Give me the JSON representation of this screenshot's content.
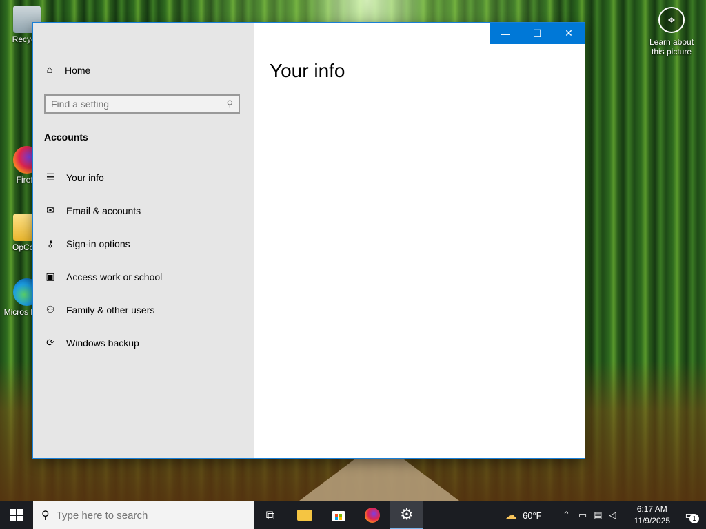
{
  "desktop": {
    "icons": [
      {
        "label": "Recycle",
        "icon": "recycle-bin-icon"
      },
      {
        "label": "Firefo",
        "icon": "firefox-icon"
      },
      {
        "label": "OpCore",
        "icon": "folder-icon"
      },
      {
        "label": "Micros Edge",
        "icon": "edge-icon"
      }
    ],
    "learn_about": "Learn about this picture"
  },
  "window": {
    "buttons": {
      "minimize": "—",
      "maximize": "☐",
      "close": "✕"
    },
    "sidebar": {
      "home_label": "Home",
      "search_placeholder": "Find a setting",
      "section_title": "Accounts",
      "items": [
        {
          "label": "Your info",
          "icon": "your-info-icon"
        },
        {
          "label": "Email & accounts",
          "icon": "mail-icon"
        },
        {
          "label": "Sign-in options",
          "icon": "key-icon"
        },
        {
          "label": "Access work or school",
          "icon": "briefcase-icon"
        },
        {
          "label": "Family & other users",
          "icon": "person-add-icon"
        },
        {
          "label": "Windows backup",
          "icon": "sync-icon"
        }
      ]
    },
    "main": {
      "title": "Your info"
    }
  },
  "taskbar": {
    "search_placeholder": "Type here to search",
    "weather": "60°F",
    "time": "6:17 AM",
    "date": "11/9/2025",
    "notification_count": "1"
  },
  "colors": {
    "accent": "#0078d7",
    "sidebar": "#e6e6e6",
    "taskbar": "#1b1d22"
  }
}
